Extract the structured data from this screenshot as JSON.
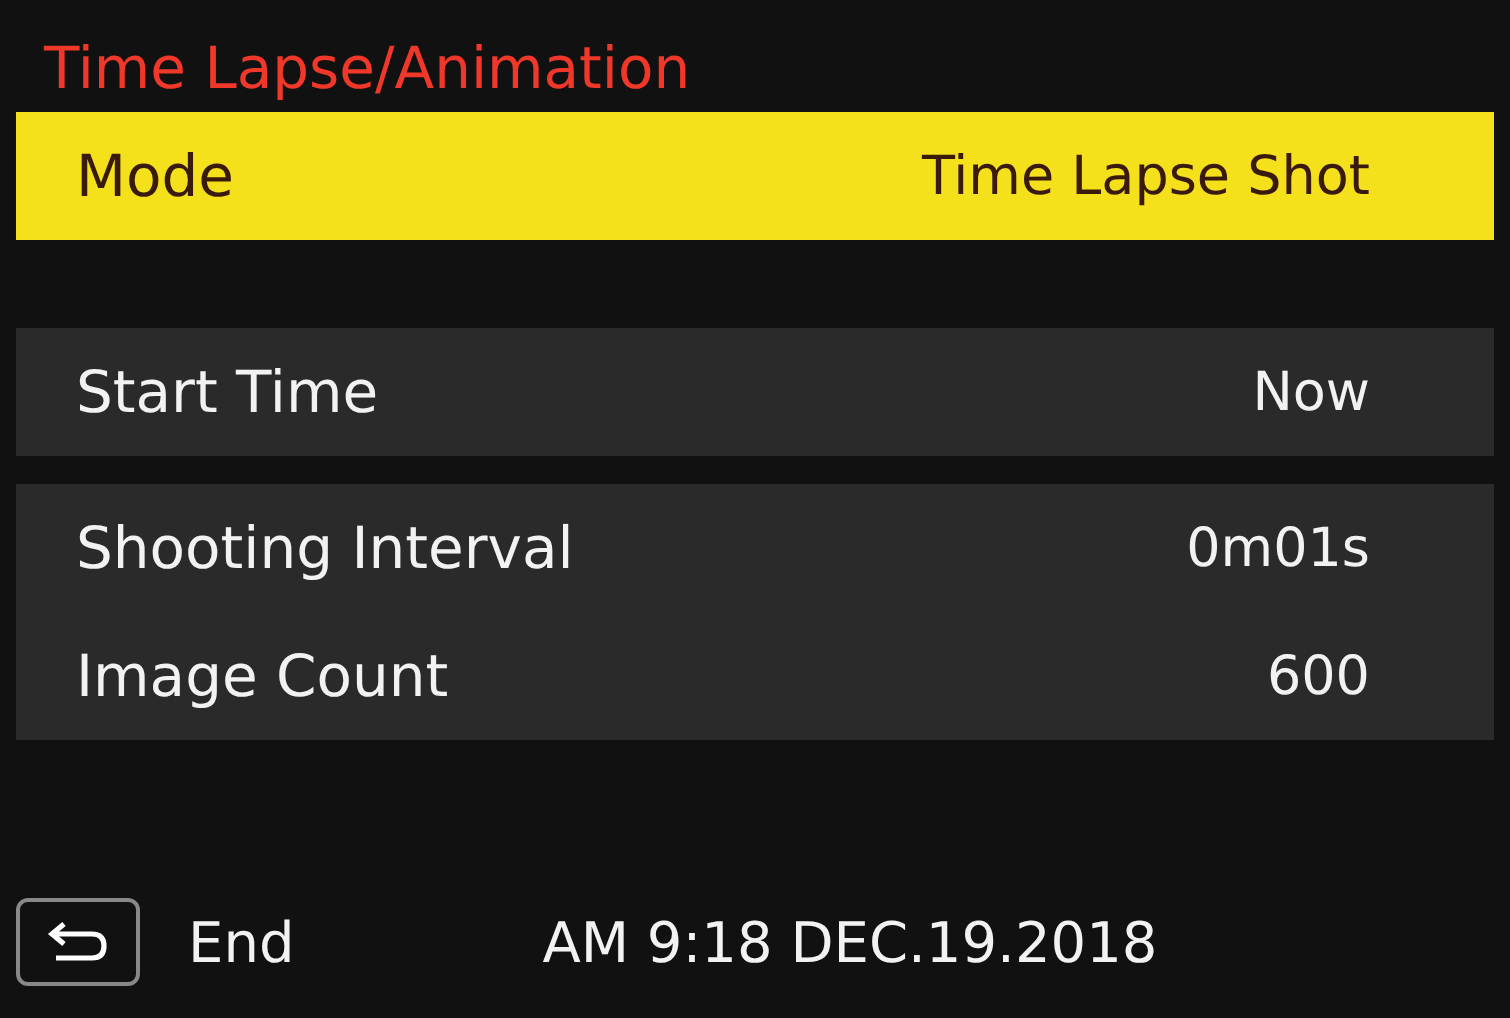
{
  "title": "Time Lapse/Animation",
  "groups": [
    {
      "items": [
        {
          "label": "Mode",
          "value": "Time Lapse Shot",
          "selected": true
        }
      ]
    },
    {
      "items": [
        {
          "label": "Start Time",
          "value": "Now",
          "selected": false
        }
      ]
    },
    {
      "items": [
        {
          "label": "Shooting Interval",
          "value": "0m01s",
          "selected": false
        },
        {
          "label": "Image Count",
          "value": "600",
          "selected": false
        }
      ]
    }
  ],
  "footer": {
    "back_label": "End",
    "datetime": "AM 9:18 DEC.19.2018"
  }
}
